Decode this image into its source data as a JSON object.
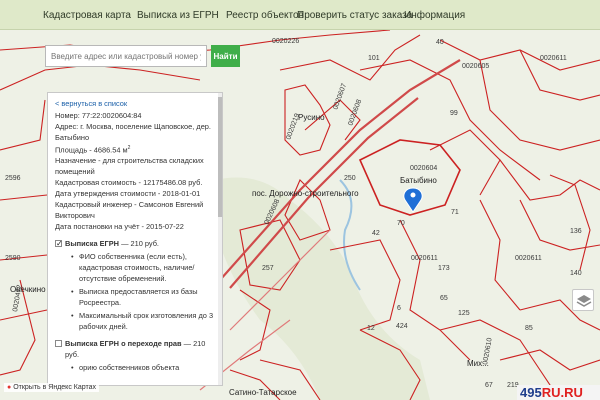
{
  "nav": {
    "items": [
      {
        "label": "Кадастровая карта"
      },
      {
        "label": "Выписка из ЕГРН"
      },
      {
        "label": "Реестр объектов"
      },
      {
        "label": "Проверить статус заказа"
      },
      {
        "label": "Информация"
      }
    ]
  },
  "search": {
    "placeholder": "Введите адрес или кадастровый номер участ",
    "button_label": "Найти"
  },
  "panel": {
    "back_link": "< вернуться в список",
    "number": "Номер: 77:22:0020604:84",
    "address": "Адрес: г. Москва, поселение Щаповское, дер. Батыбино",
    "area_prefix": "Площадь - 4686.54 м",
    "area_sup": "2",
    "purpose": "Назначение - для строительства складских помещений",
    "cadastral_value": "Кадастровая стоимость - 12175486.08 руб.",
    "approval_date": "Дата утверждения стоимости - 2018-01-01",
    "engineer": "Кадастровый инженер - Самсонов Евгений Викторович",
    "registration_date": "Дата постановки на учёт - 2015-07-22",
    "option1": {
      "title": "Выписка ЕГРН",
      "price": " — 210 руб.",
      "checked": true,
      "bullets": [
        "ФИО собственника (если есть), кадастровая стоимость, наличие/отсутствие обременений.",
        "Выписка предоставляется из базы Росреестра.",
        "Максимальный срок изготовления до 3 рабочих дней."
      ]
    },
    "option2": {
      "title": "Выписка ЕГРН о переходе прав",
      "price": " — 210 руб.",
      "checked": false,
      "bullet_partial": "орию собственников объекта"
    }
  },
  "map": {
    "parcel_labels": [
      {
        "text": "0020226"
      },
      {
        "text": "0020605"
      },
      {
        "text": "0020611"
      },
      {
        "text": "0020611"
      },
      {
        "text": "0020607"
      },
      {
        "text": "0020219"
      },
      {
        "text": "0020608"
      },
      {
        "text": "0020604"
      },
      {
        "text": "0020611"
      },
      {
        "text": "0020611"
      },
      {
        "text": "0020608"
      },
      {
        "text": "0020472"
      },
      {
        "text": "0020610"
      }
    ],
    "number_labels": [
      "40",
      "101",
      "99",
      "250",
      "71",
      "42",
      "70",
      "2596",
      "2590",
      "136",
      "140",
      "173",
      "65",
      "85",
      "6",
      "424",
      "257",
      "67",
      "219",
      "125",
      "12"
    ],
    "place_labels": [
      "Русино",
      "пос. Дорожно-строительного",
      "Батыбино",
      "Овечкино",
      "Сатино-Татарское",
      "Мих..."
    ]
  },
  "footer": {
    "yandex_link": "Открыть в Яндекс Картах",
    "watermark_main": "495",
    "watermark_accent": "RU.RU"
  },
  "colors": {
    "nav_bg": "#dfe9c9",
    "parcel_border": "#cc2222",
    "road": "#d04a4a",
    "search_button": "#3fae49",
    "link": "#1a5fa8"
  },
  "icons": {
    "marker": "location-pin-icon",
    "layers": "layers-icon",
    "yandex": "map-pin-icon"
  }
}
